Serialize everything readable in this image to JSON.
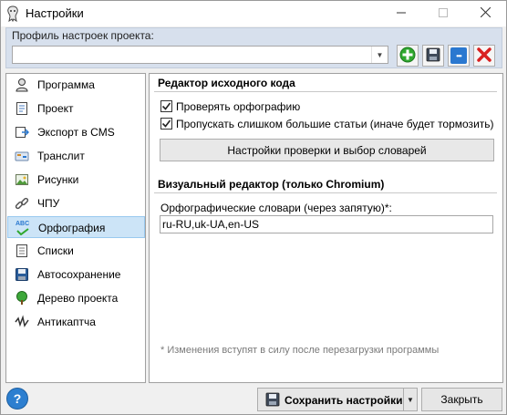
{
  "window": {
    "title": "Настройки",
    "controls": {
      "minimize": "—",
      "close": "✕"
    }
  },
  "profile": {
    "label": "Профиль настроек проекта:",
    "value": "",
    "dropdown_arrow": "▼",
    "buttons": {
      "add": "add-icon",
      "save": "save-icon",
      "more_glyph": "•••",
      "delete": "delete-icon"
    }
  },
  "sidebar": {
    "items": [
      {
        "label": "Программа",
        "icon": "user-icon"
      },
      {
        "label": "Проект",
        "icon": "document-icon"
      },
      {
        "label": "Экспорт в CMS",
        "icon": "export-icon"
      },
      {
        "label": "Транслит",
        "icon": "translit-icon"
      },
      {
        "label": "Рисунки",
        "icon": "image-icon"
      },
      {
        "label": "ЧПУ",
        "icon": "link-icon"
      },
      {
        "label": "Орфография",
        "icon": "spellcheck-icon",
        "icon_text": "ABC",
        "selected": true
      },
      {
        "label": "Списки",
        "icon": "list-icon"
      },
      {
        "label": "Автосохранение",
        "icon": "autosave-icon"
      },
      {
        "label": "Дерево проекта",
        "icon": "tree-icon"
      },
      {
        "label": "Антикаптча",
        "icon": "anticaptcha-icon"
      }
    ]
  },
  "editor": {
    "source_section_title": "Редактор исходного кода",
    "check_spelling_label": "Проверять орфографию",
    "check_spelling_checked": true,
    "skip_large_label": "Пропускать слишком большие статьи (иначе будет тормозить)",
    "skip_large_checked": true,
    "dictionary_settings_button": "Настройки проверки и выбор словарей",
    "visual_section_title": "Визуальный редактор (только Chromium)",
    "dictionaries_label": "Орфографические словари (через запятую)*:",
    "dictionaries_value": "ru-RU,uk-UA,en-US",
    "note": "* Изменения вступят в силу после перезагрузки программы"
  },
  "footer": {
    "help_glyph": "?",
    "save_label": "Сохранить настройки",
    "save_dropdown_arrow": "▼",
    "close_label": "Закрыть"
  },
  "colors": {
    "profile_panel_bg": "#d7e0ed",
    "selected_item_bg": "#cce4f7",
    "add_green": "#2fa82f",
    "delete_red": "#d92020",
    "more_blue": "#2a78d0",
    "help_blue": "#2d7fd0"
  }
}
